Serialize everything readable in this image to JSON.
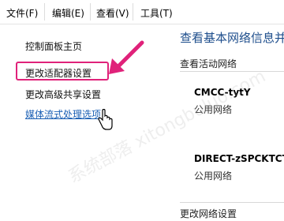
{
  "menubar": {
    "items": [
      "文件(F)",
      "编辑(E)",
      "查看(V)",
      "工具(T)"
    ]
  },
  "nav": {
    "home": "控制面板主页",
    "change_adapter": "更改适配器设置",
    "change_sharing": "更改高级共享设置",
    "media_streaming": "媒体流式处理选项"
  },
  "main": {
    "title": "查看基本网络信息并",
    "active_networks_label": "查看活动网络",
    "networks": [
      {
        "name": "CMCC-tytY",
        "type": "公用网络"
      },
      {
        "name": "DIRECT-zSPCKTCT.",
        "type": "公用网络"
      }
    ],
    "change_settings_label": "更改网络设置"
  },
  "colors": {
    "highlight": "#e0227a",
    "link": "#1a5fb4",
    "title": "#1e4e8c"
  },
  "watermark": "系统部落 xitongbuluo.com"
}
